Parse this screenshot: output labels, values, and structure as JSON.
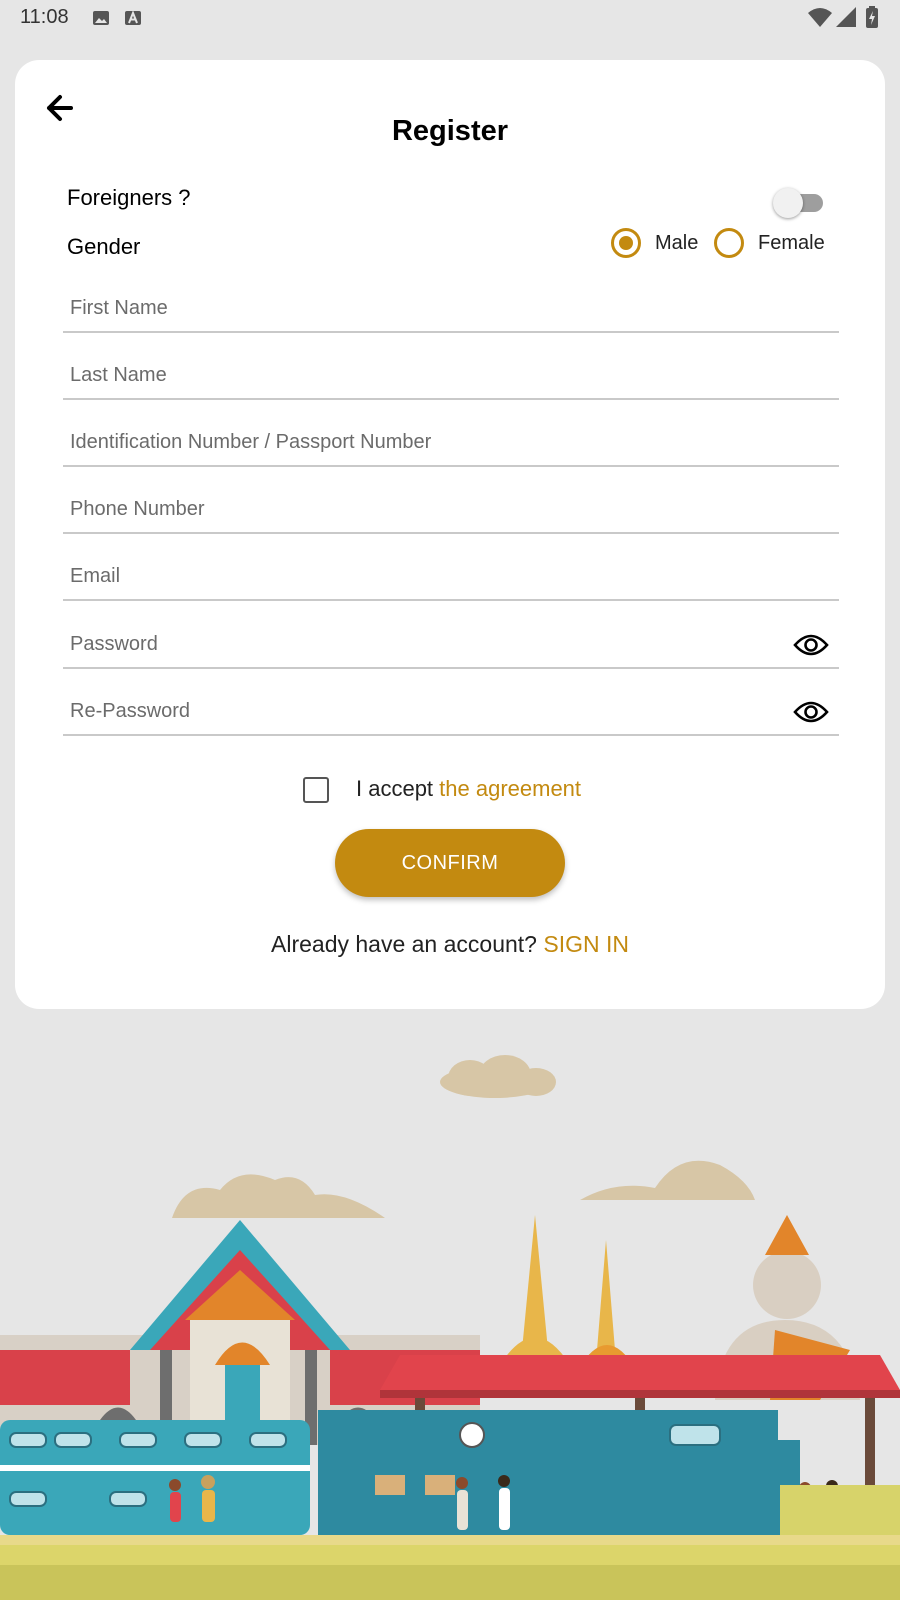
{
  "status_bar": {
    "time": "11:08",
    "icons": [
      "image-icon",
      "a-letter-icon",
      "wifi-icon",
      "cell-signal-icon",
      "battery-icon"
    ]
  },
  "header": {
    "back_icon": "arrow-left-icon",
    "title": "Register"
  },
  "foreigners": {
    "label": "Foreigners ?",
    "toggle_on": false
  },
  "gender": {
    "label": "Gender",
    "options": [
      {
        "label": "Male",
        "selected": true
      },
      {
        "label": "Female",
        "selected": false
      }
    ]
  },
  "fields": {
    "first_name": {
      "placeholder": "First Name",
      "value": ""
    },
    "last_name": {
      "placeholder": "Last Name",
      "value": ""
    },
    "id_number": {
      "placeholder": "Identification Number / Passport Number",
      "value": ""
    },
    "phone": {
      "placeholder": "Phone Number",
      "value": ""
    },
    "email": {
      "placeholder": "Email",
      "value": ""
    },
    "password": {
      "placeholder": "Password",
      "value": "",
      "icon": "eye-icon"
    },
    "re_password": {
      "placeholder": "Re-Password",
      "value": "",
      "icon": "eye-icon"
    }
  },
  "agreement": {
    "checked": false,
    "prefix": "I accept ",
    "link": "the agreement"
  },
  "confirm_label": "CONFIRM",
  "signin": {
    "prompt": "Already have an account? ",
    "link": "SIGN IN"
  },
  "colors": {
    "accent": "#c38a10",
    "background": "#e6e6e6",
    "card": "#ffffff",
    "placeholder": "#6b6b6b"
  }
}
